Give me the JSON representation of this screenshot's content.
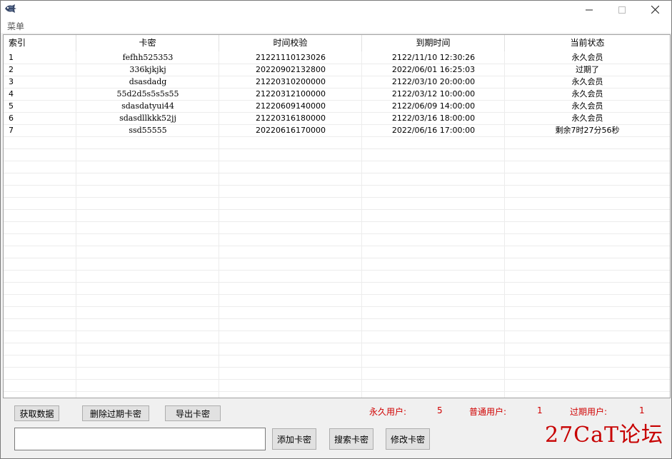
{
  "menubar": {
    "menu_label": "菜单"
  },
  "grid": {
    "columns": [
      "索引",
      "卡密",
      "时间校验",
      "到期时间",
      "当前状态"
    ],
    "rows": [
      [
        "1",
        "fefhh525353",
        "21221110123026",
        "2122/11/10 12:30:26",
        "永久会员"
      ],
      [
        "2",
        "336kjkjkj",
        "20220902132800",
        "2022/06/01 16:25:03",
        "过期了"
      ],
      [
        "3",
        "dsasdadg",
        "21220310200000",
        "2122/03/10 20:00:00",
        "永久会员"
      ],
      [
        "4",
        "55d2d5s5s5s55",
        "21220312100000",
        "2122/03/12 10:00:00",
        "永久会员"
      ],
      [
        "5",
        "sdasdatyui44",
        "21220609140000",
        "2122/06/09 14:00:00",
        "永久会员"
      ],
      [
        "6",
        "sdasdllkkk52jj",
        "21220316180000",
        "2122/03/16 18:00:00",
        "永久会员"
      ],
      [
        "7",
        "ssd55555",
        "20220616170000",
        "2022/06/16 17:00:00",
        "剩余7时27分56秒"
      ]
    ]
  },
  "toolbar": {
    "fetch_label": "获取数据",
    "delete_expired_label": "删除过期卡密",
    "export_label": "导出卡密",
    "add_label": "添加卡密",
    "search_label": "搜索卡密",
    "modify_label": "修改卡密"
  },
  "stats": {
    "permanent_label": "永久用户:",
    "permanent_count": "5",
    "normal_label": "普通用户:",
    "normal_count": "1",
    "expired_label": "过期用户:",
    "expired_count": "1"
  },
  "input": {
    "value": ""
  },
  "watermark": {
    "text": "27CaT论坛"
  },
  "colors": {
    "stat_red": "#d00000",
    "watermark_red": "#c70000"
  }
}
